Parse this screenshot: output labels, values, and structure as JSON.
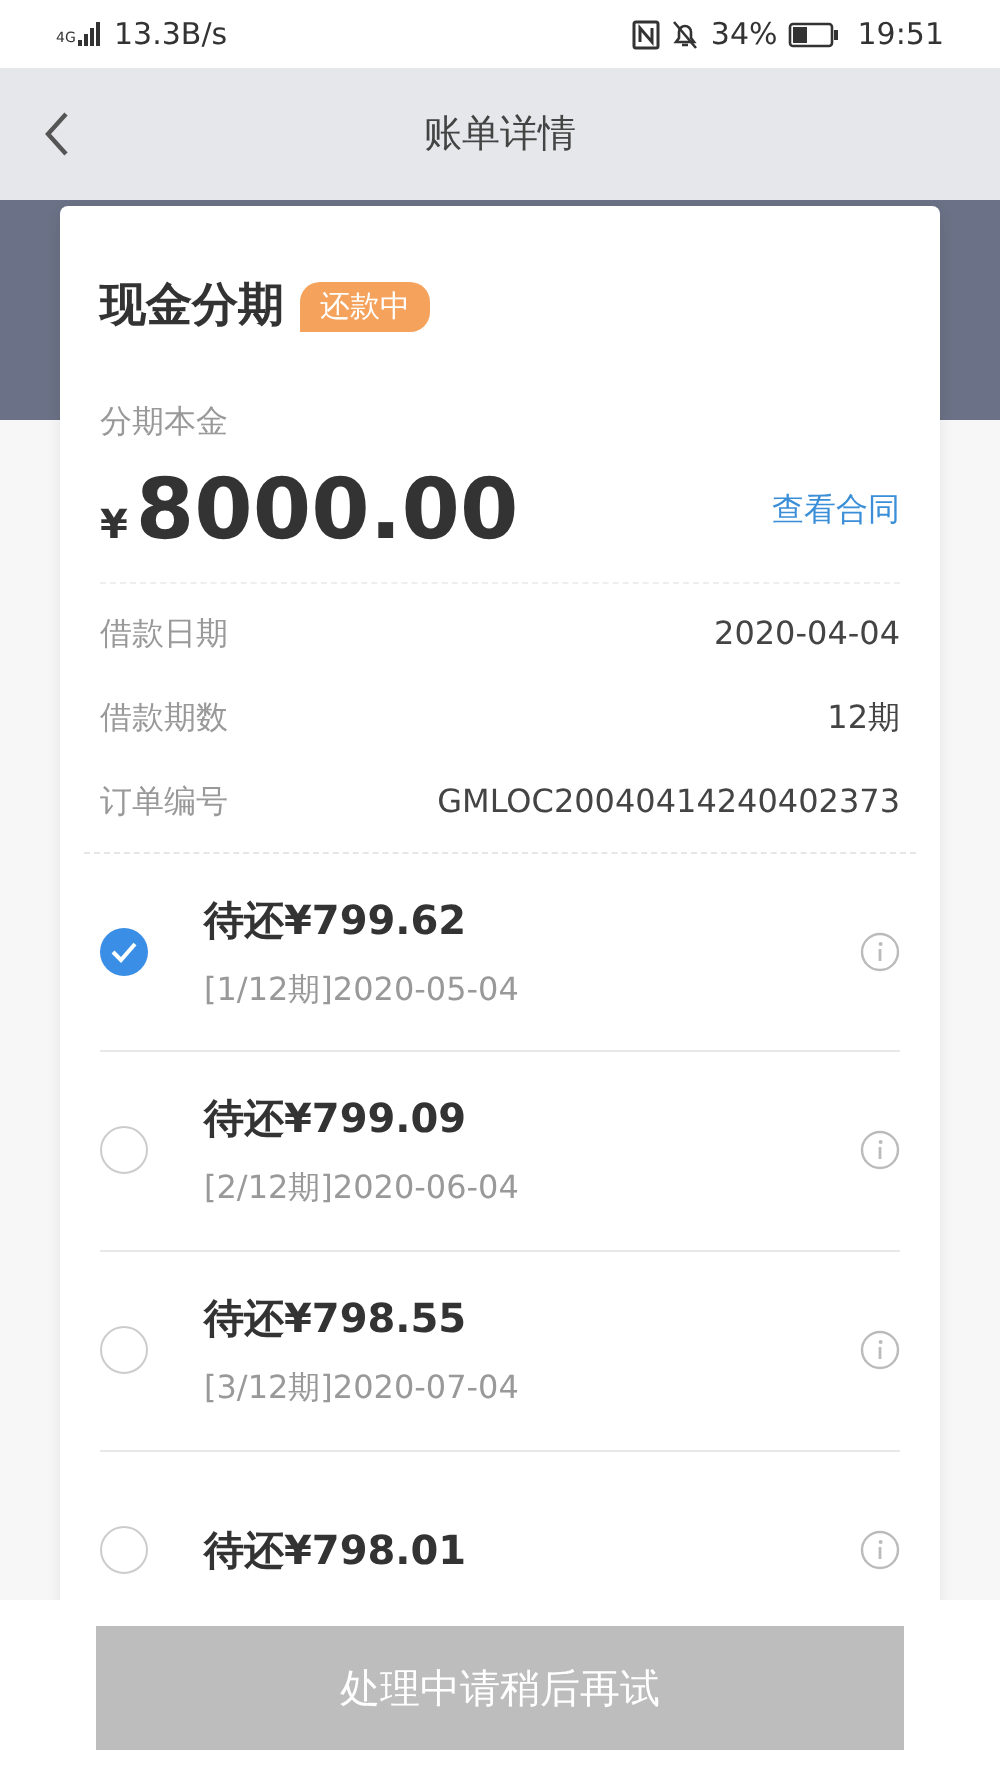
{
  "status_bar": {
    "network": "4G",
    "speed": "13.3B/s",
    "battery": "34%",
    "time": "19:51"
  },
  "header": {
    "title": "账单详情"
  },
  "summary": {
    "title": "现金分期",
    "status": "还款中",
    "principal_label": "分期本金",
    "currency": "¥",
    "amount": "8000.00",
    "contract_link": "查看合同",
    "details": [
      {
        "label": "借款日期",
        "value": "2020-04-04"
      },
      {
        "label": "借款期数",
        "value": "12期"
      },
      {
        "label": "订单编号",
        "value": "GMLOC20040414240402373"
      }
    ]
  },
  "installments": [
    {
      "amount": "待还¥799.62",
      "period": "[1/12期]2020-05-04",
      "selected": true
    },
    {
      "amount": "待还¥799.09",
      "period": "[2/12期]2020-06-04",
      "selected": false
    },
    {
      "amount": "待还¥798.55",
      "period": "[3/12期]2020-07-04",
      "selected": false
    },
    {
      "amount": "待还¥798.01",
      "selected": false
    }
  ],
  "action_button": {
    "label": "处理中请稍后再试",
    "disabled": true
  }
}
